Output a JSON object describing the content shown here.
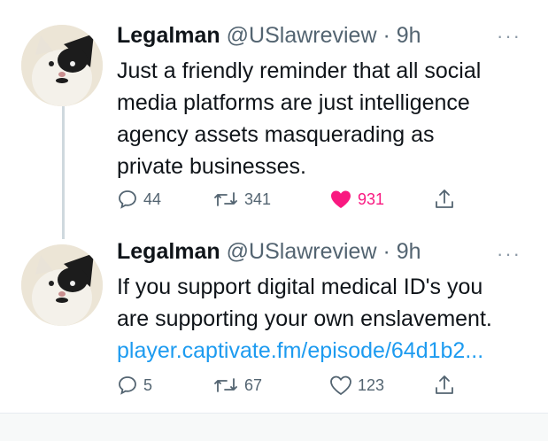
{
  "tweets": [
    {
      "name": "Legalman",
      "handle": "@USlawreview",
      "dot": "·",
      "time": "9h",
      "more": "···",
      "text_lines": [
        "Just a friendly reminder that all social",
        "media platforms are just intelligence",
        "agency assets masquerading as",
        "private businesses."
      ],
      "link": "",
      "replies": "44",
      "retweets": "341",
      "likes": "931",
      "liked": true
    },
    {
      "name": "Legalman",
      "handle": "@USlawreview",
      "dot": "·",
      "time": "9h",
      "more": "···",
      "text_lines": [
        "If you support digital medical ID's you",
        "are supporting your own enslavement."
      ],
      "link": "player.captivate.fm/episode/64d1b2...",
      "replies": "5",
      "retweets": "67",
      "likes": "123",
      "liked": false
    }
  ],
  "icons": {
    "reply": "reply-icon",
    "retweet": "retweet-icon",
    "like": "heart-icon",
    "share": "share-icon"
  },
  "colors": {
    "text": "#0f1419",
    "muted": "#536471",
    "link": "#1d9bf0",
    "like": "#f91880",
    "thread_line": "#cfd9de"
  }
}
